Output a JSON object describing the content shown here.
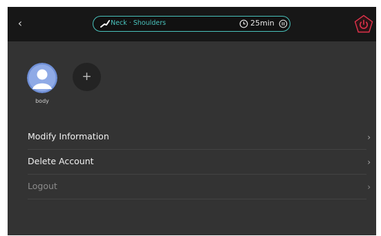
{
  "topbar": {
    "back_icon": "chevron-left-icon",
    "mode_label": "Neck · Shoulders",
    "time_label": "25min",
    "power_icon": "power-icon",
    "accent_color": "#49c3bd",
    "power_color": "#e0324b"
  },
  "profile": {
    "users": [
      {
        "label": "body"
      }
    ],
    "add_label": "+"
  },
  "menu": {
    "items": [
      {
        "label": "Modify Information"
      },
      {
        "label": "Delete Account"
      },
      {
        "label": "Logout"
      }
    ],
    "chevron": "›"
  }
}
